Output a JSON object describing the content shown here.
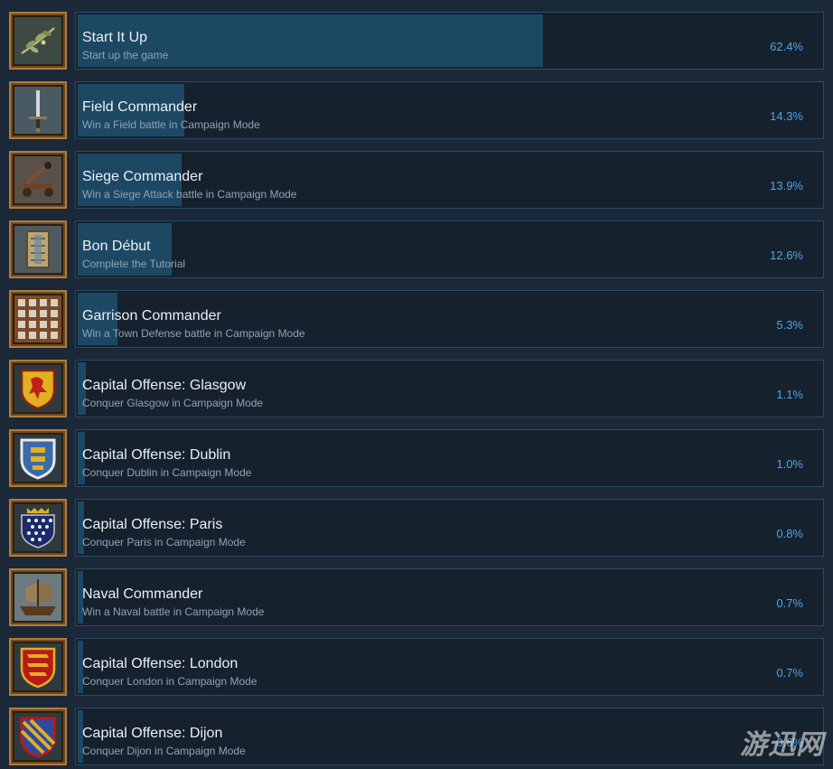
{
  "achievements": [
    {
      "icon": "olive-branch-icon",
      "title": "Start It Up",
      "description": "Start up the game",
      "percent_label": "62.4%",
      "percent": 62.4
    },
    {
      "icon": "sword-icon",
      "title": "Field Commander",
      "description": "Win a Field battle in Campaign Mode",
      "percent_label": "14.3%",
      "percent": 14.3
    },
    {
      "icon": "catapult-icon",
      "title": "Siege Commander",
      "description": "Win a Siege Attack battle in Campaign Mode",
      "percent_label": "13.9%",
      "percent": 13.9
    },
    {
      "icon": "shield-book-icon",
      "title": "Bon Début",
      "description": "Complete the Tutorial",
      "percent_label": "12.6%",
      "percent": 12.6
    },
    {
      "icon": "town-wall-icon",
      "title": "Garrison Commander",
      "description": "Win a Town Defense battle in Campaign Mode",
      "percent_label": "5.3%",
      "percent": 5.3
    },
    {
      "icon": "scotland-crest-icon",
      "title": "Capital Offense: Glasgow",
      "description": "Conquer Glasgow in Campaign Mode",
      "percent_label": "1.1%",
      "percent": 1.1
    },
    {
      "icon": "ireland-crest-icon",
      "title": "Capital Offense: Dublin",
      "description": "Conquer Dublin in Campaign Mode",
      "percent_label": "1.0%",
      "percent": 1.0
    },
    {
      "icon": "france-crest-icon",
      "title": "Capital Offense: Paris",
      "description": "Conquer Paris in Campaign Mode",
      "percent_label": "0.8%",
      "percent": 0.8
    },
    {
      "icon": "ship-icon",
      "title": "Naval Commander",
      "description": "Win a Naval battle in Campaign Mode",
      "percent_label": "0.7%",
      "percent": 0.7
    },
    {
      "icon": "england-crest-icon",
      "title": "Capital Offense: London",
      "description": "Conquer London in Campaign Mode",
      "percent_label": "0.7%",
      "percent": 0.7
    },
    {
      "icon": "burgundy-crest-icon",
      "title": "Capital Offense: Dijon",
      "description": "Conquer Dijon in Campaign Mode",
      "percent_label": "0.6%",
      "percent": 0.6
    }
  ],
  "watermark": "游迅网",
  "colors": {
    "background": "#1b2838",
    "bar_fill": "#1d4864",
    "card_border": "#2a4a66",
    "percent_text": "#4ea6e8",
    "icon_frame": "#b37a3c"
  }
}
